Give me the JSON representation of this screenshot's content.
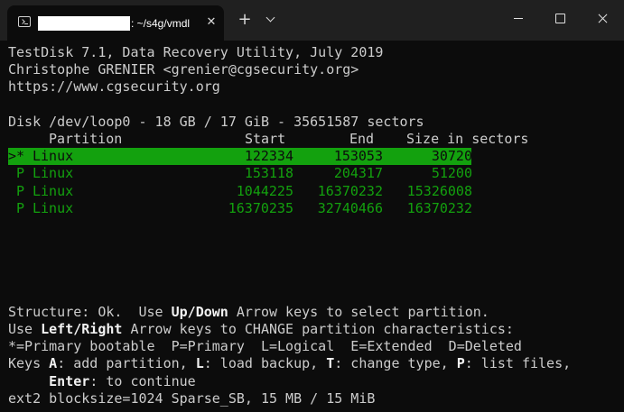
{
  "window": {
    "tab_title": ": ~/s4g/vmdl",
    "close_glyph": "✕",
    "newtab_glyph": "+",
    "colors": {
      "background": "#0c0c0c",
      "titlebar": "#202020",
      "text": "#cccccc",
      "green": "#13a10e"
    }
  },
  "terminal": {
    "header": [
      "TestDisk 7.1, Data Recovery Utility, July 2019",
      "Christophe GRENIER <grenier@cgsecurity.org>",
      "https://www.cgsecurity.org"
    ],
    "disk_line": "Disk /dev/loop0 - 18 GB / 17 GiB - 35651587 sectors",
    "columns": {
      "partition": "Partition",
      "start": "Start",
      "end": "End",
      "size": "Size in sectors"
    },
    "partitions": [
      {
        "marker": ">*",
        "type": "Linux",
        "start": "122334",
        "end": "153053",
        "size": "30720"
      },
      {
        "marker": " P",
        "type": "Linux",
        "start": "153118",
        "end": "204317",
        "size": "51200"
      },
      {
        "marker": " P",
        "type": "Linux",
        "start": "1044225",
        "end": "16370232",
        "size": "15326008"
      },
      {
        "marker": " P",
        "type": "Linux",
        "start": "16370235",
        "end": "32740466",
        "size": "16370232"
      }
    ],
    "help": {
      "l1_a": "Structure: Ok.  Use ",
      "l1_key": "Up/Down",
      "l1_b": " Arrow keys to select partition.",
      "l2_a": "Use ",
      "l2_key": "Left/Right",
      "l2_b": " Arrow keys to CHANGE partition characteristics:",
      "l3": "*=Primary bootable  P=Primary  L=Logical  E=Extended  D=Deleted",
      "l4_a": "Keys ",
      "l4_k1": "A",
      "l4_b": ": add partition, ",
      "l4_k2": "L",
      "l4_c": ": load backup, ",
      "l4_k3": "T",
      "l4_d": ": change type, ",
      "l4_k4": "P",
      "l4_e": ": list files,",
      "l5_indent": "     ",
      "l5_key": "Enter",
      "l5_b": ": to continue",
      "l6": "ext2 blocksize=1024 Sparse_SB, 15 MB / 15 MiB"
    }
  }
}
